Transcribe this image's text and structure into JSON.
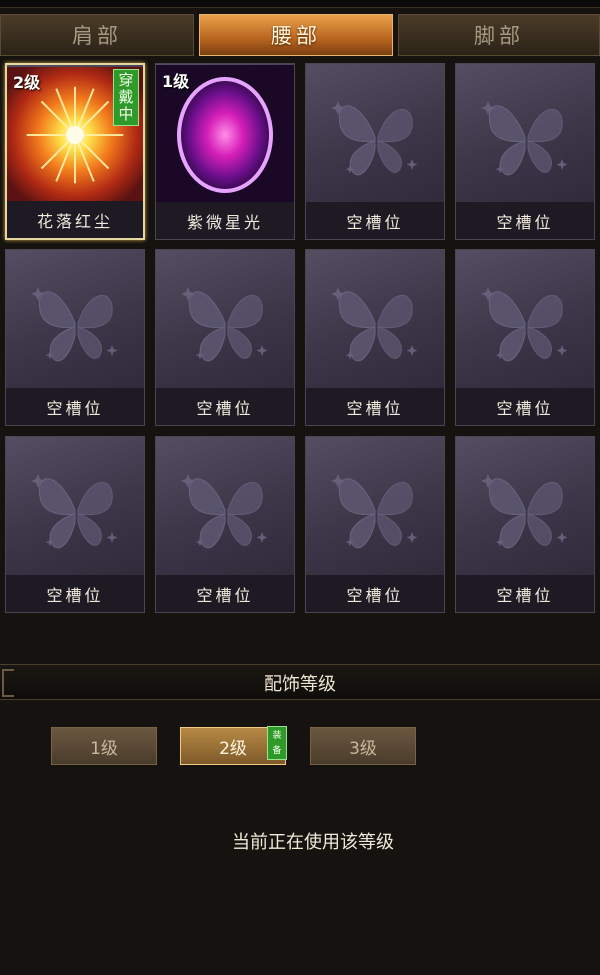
{
  "tabs": [
    {
      "label": "肩部",
      "active": false
    },
    {
      "label": "腰部",
      "active": true
    },
    {
      "label": "脚部",
      "active": false
    }
  ],
  "slots": [
    {
      "name": "花落红尘",
      "level": "2级",
      "badge": "穿戴中",
      "art": "sun-burst-icon",
      "selected": true
    },
    {
      "name": "紫微星光",
      "level": "1级",
      "badge": "",
      "art": "purple-orb-icon",
      "selected": false
    },
    {
      "name": "空槽位"
    },
    {
      "name": "空槽位"
    },
    {
      "name": "空槽位"
    },
    {
      "name": "空槽位"
    },
    {
      "name": "空槽位"
    },
    {
      "name": "空槽位"
    },
    {
      "name": "空槽位"
    },
    {
      "name": "空槽位"
    },
    {
      "name": "空槽位"
    },
    {
      "name": "空槽位"
    }
  ],
  "section_title": "配饰等级",
  "levels": [
    {
      "label": "1级",
      "active": false
    },
    {
      "label": "2级",
      "active": true
    },
    {
      "label": "3级",
      "active": false
    }
  ],
  "equip_badge": "装备",
  "status_text": "当前正在使用该等级",
  "colors": {
    "accent_orange": "#e9a04a",
    "badge_green": "#2e9a2a",
    "slot_purple": "#3c3749"
  }
}
